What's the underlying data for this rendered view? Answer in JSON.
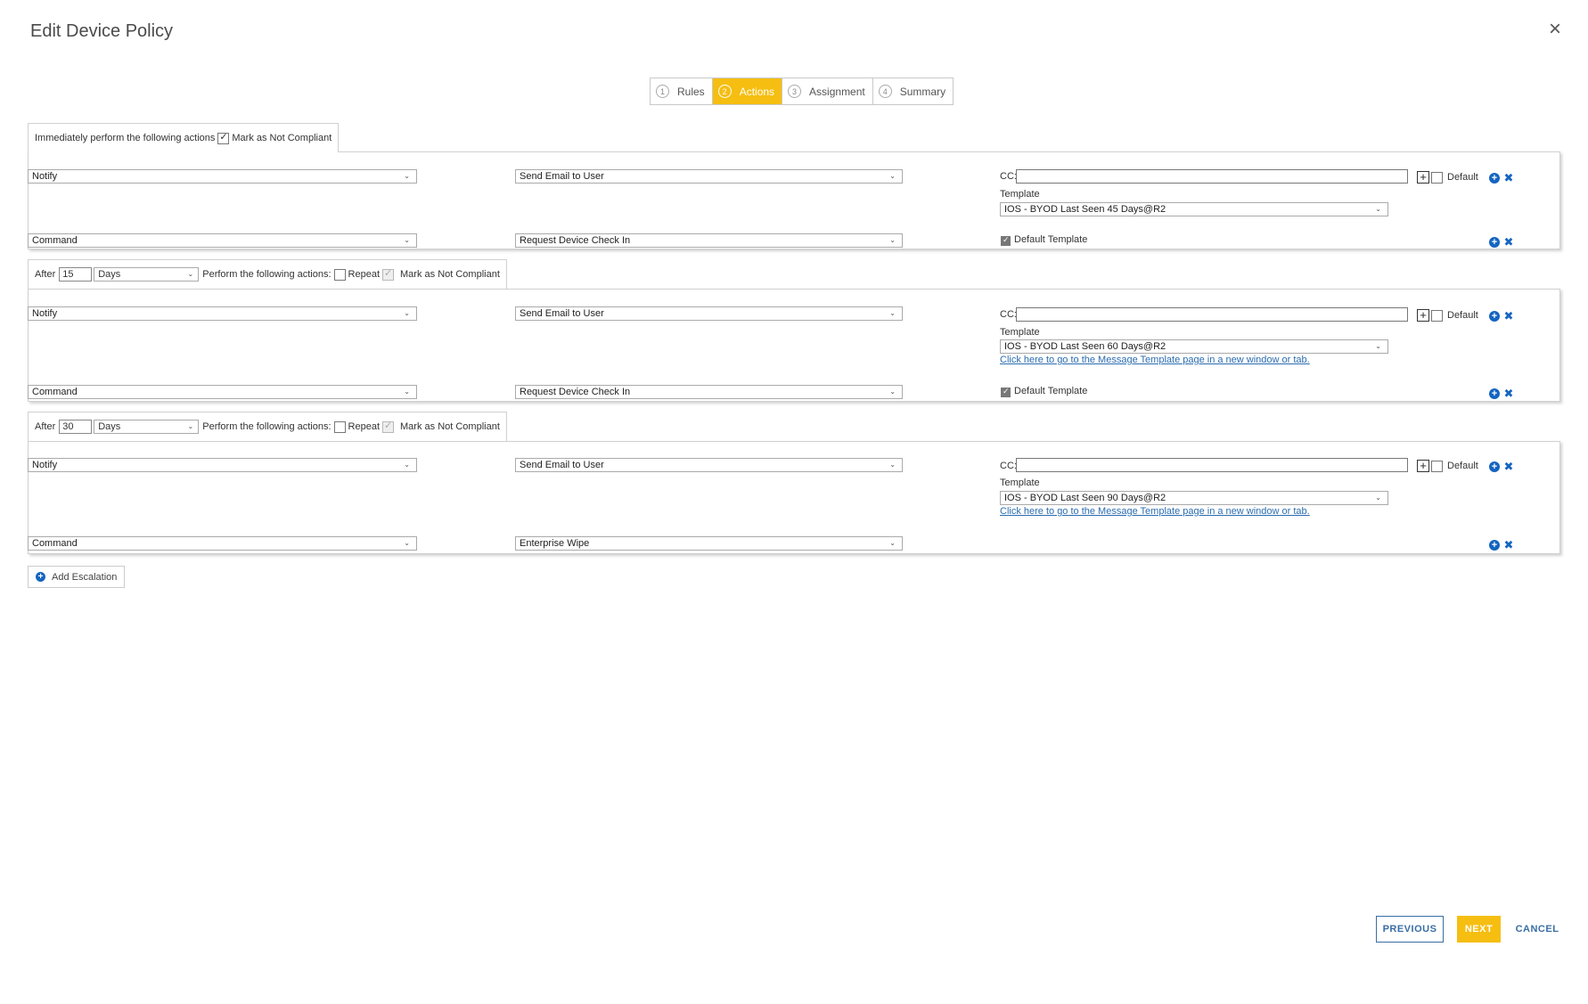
{
  "dialog": {
    "title": "Edit Device Policy",
    "close_symbol": "×"
  },
  "steps": [
    {
      "num": "1",
      "label": "Rules",
      "active": false
    },
    {
      "num": "2",
      "label": "Actions",
      "active": true
    },
    {
      "num": "3",
      "label": "Assignment",
      "active": false
    },
    {
      "num": "4",
      "label": "Summary",
      "active": false
    }
  ],
  "sections": [
    {
      "header": {
        "text": "Immediately perform the following actions",
        "mark_not_compliant_label": "Mark as Not Compliant",
        "mark_not_compliant_checked": true
      },
      "notify": {
        "type": "Notify",
        "action": "Send Email to User",
        "cc_label": "CC:",
        "cc_value": "",
        "default_label": "Default",
        "default_checked": false,
        "template_label": "Template",
        "template_value": "IOS - BYOD Last Seen 45 Days@R2",
        "template_link": ""
      },
      "command": {
        "type": "Command",
        "action": "Request Device Check In",
        "default_template_label": "Default Template",
        "default_template_checked": true
      }
    },
    {
      "header": {
        "after_label": "After",
        "after_value": "15",
        "unit": "Days",
        "perform_label": "Perform the following actions:",
        "repeat_label": "Repeat",
        "repeat_checked": false,
        "mark_not_compliant_label": "Mark as Not Compliant",
        "mark_not_compliant_checked": true
      },
      "notify": {
        "type": "Notify",
        "action": "Send Email to User",
        "cc_label": "CC:",
        "cc_value": "",
        "default_label": "Default",
        "default_checked": false,
        "template_label": "Template",
        "template_value": "IOS - BYOD Last Seen 60 Days@R2",
        "template_link": "Click here to go to the Message Template page in a new window or tab."
      },
      "command": {
        "type": "Command",
        "action": "Request Device Check In",
        "default_template_label": "Default Template",
        "default_template_checked": true
      }
    },
    {
      "header": {
        "after_label": "After",
        "after_value": "30",
        "unit": "Days",
        "perform_label": "Perform the following actions:",
        "repeat_label": "Repeat",
        "repeat_checked": false,
        "mark_not_compliant_label": "Mark as Not Compliant",
        "mark_not_compliant_checked": true
      },
      "notify": {
        "type": "Notify",
        "action": "Send Email to User",
        "cc_label": "CC:",
        "cc_value": "",
        "default_label": "Default",
        "default_checked": false,
        "template_label": "Template",
        "template_value": "IOS - BYOD Last Seen 90 Days@R2",
        "template_link": "Click here to go to the Message Template page in a new window or tab."
      },
      "command": {
        "type": "Command",
        "action": "Enterprise Wipe",
        "default_template_label": "",
        "default_template_checked": false
      }
    }
  ],
  "add_escalation_label": "Add Escalation",
  "footer": {
    "previous": "PREVIOUS",
    "next": "NEXT",
    "cancel": "CANCEL"
  },
  "colors": {
    "accent": "#f5be11",
    "link": "#2b6cb0",
    "icon_blue": "#1565c0"
  }
}
